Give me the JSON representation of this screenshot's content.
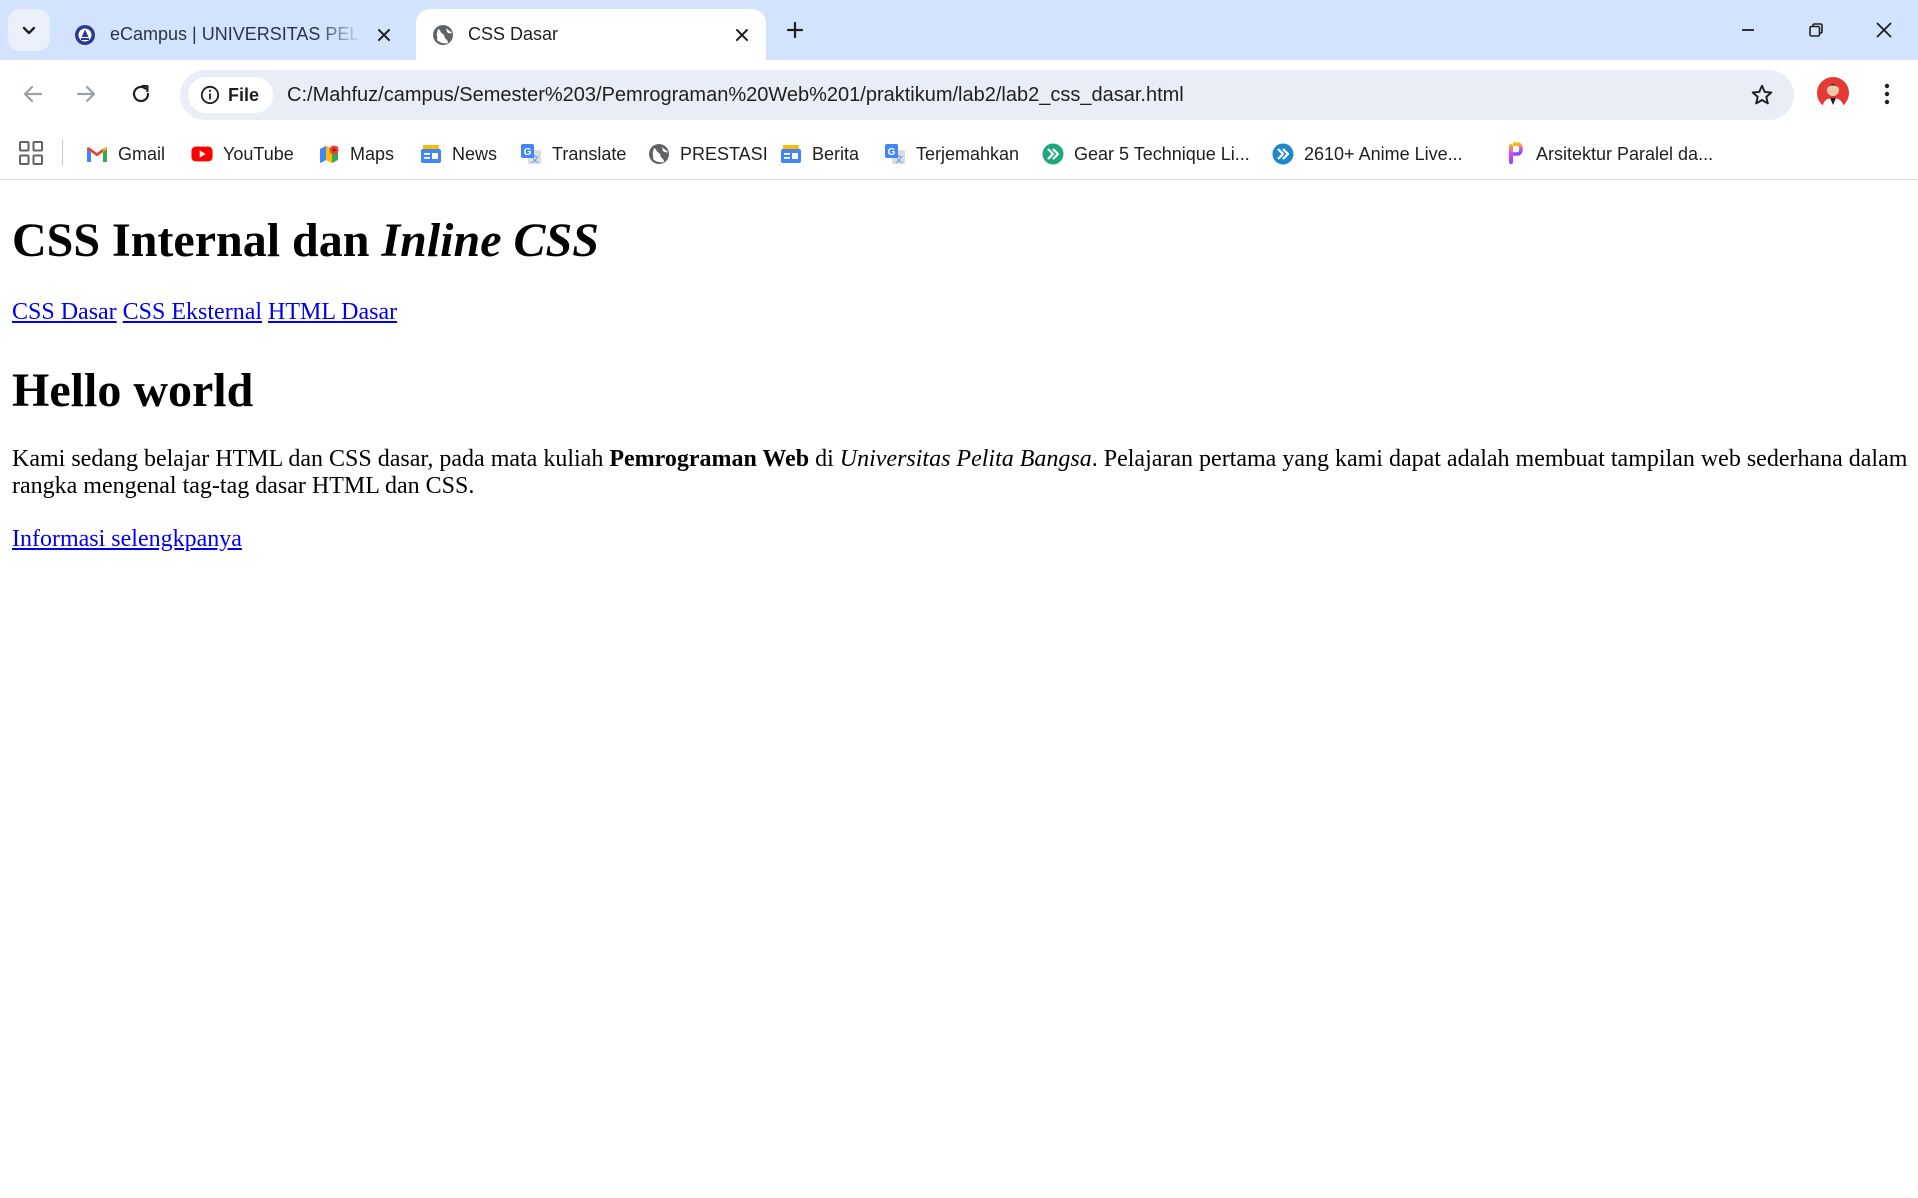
{
  "browser": {
    "tabs": [
      {
        "title": "eCampus | UNIVERSITAS PELITA BANGSA",
        "active": false
      },
      {
        "title": "CSS Dasar",
        "active": true
      }
    ],
    "address_chip": "File",
    "url": "C:/Mahfuz/campus/Semester%203/Pemrograman%20Web%201/praktikum/lab2/lab2_css_dasar.html",
    "bookmarks": [
      {
        "label": "Gmail",
        "icon": "gmail-icon"
      },
      {
        "label": "YouTube",
        "icon": "youtube-icon"
      },
      {
        "label": "Maps",
        "icon": "maps-icon"
      },
      {
        "label": "News",
        "icon": "news-icon"
      },
      {
        "label": "Translate",
        "icon": "translate-icon"
      },
      {
        "label": "PRESTASI",
        "icon": "globe-icon"
      },
      {
        "label": "Berita",
        "icon": "news-icon"
      },
      {
        "label": "Terjemahkan",
        "icon": "translate-icon"
      },
      {
        "label": "Gear 5 Technique Li...",
        "icon": "double-chevron-icon"
      },
      {
        "label": "2610+ Anime Live...",
        "icon": "double-chevron-icon"
      },
      {
        "label": "Arsitektur Paralel da...",
        "icon": "gradient-logo-icon"
      }
    ],
    "colors": {
      "tabstrip": "#d3e3fd",
      "omnibox": "#e9eef6",
      "link": "#0000ee"
    }
  },
  "page": {
    "heading1": {
      "normal": "CSS Internal dan ",
      "italic": "Inline CSS"
    },
    "nav_links": [
      "CSS Dasar",
      "CSS Eksternal",
      "HTML Dasar"
    ],
    "heading2": "Hello world",
    "paragraph": {
      "part1": "Kami sedang belajar HTML dan CSS dasar, pada mata kuliah ",
      "bold": "Pemrograman Web",
      "part2": " di ",
      "italic": "Universitas Pelita Bangsa",
      "part3": ". Pelajaran pertama yang kami dapat adalah membuat tampilan web sederhana dalam rangka mengenal tag-tag dasar HTML dan CSS."
    },
    "more_link": "Informasi selengkpanya"
  }
}
